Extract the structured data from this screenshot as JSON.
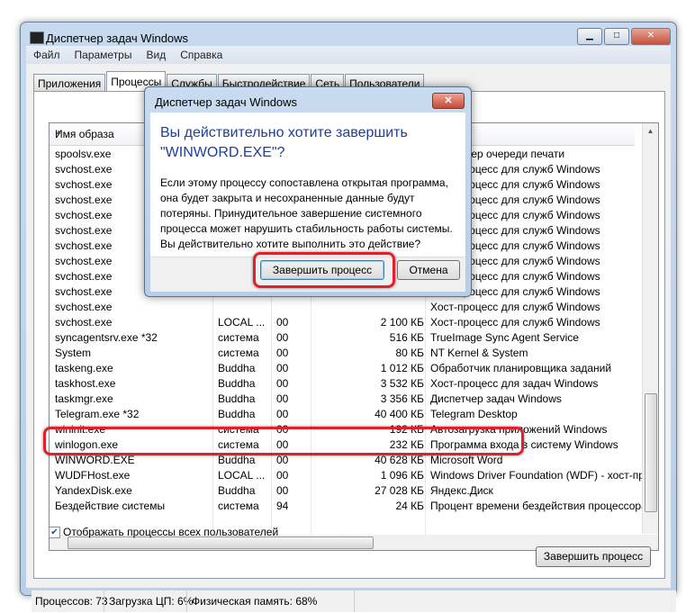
{
  "window": {
    "title": "Диспетчер задач Windows",
    "controls": [
      "minimize",
      "maximize",
      "close"
    ]
  },
  "menu": [
    "Файл",
    "Параметры",
    "Вид",
    "Справка"
  ],
  "tabs": [
    {
      "label": "Приложения"
    },
    {
      "label": "Процессы",
      "active": true
    },
    {
      "label": "Службы"
    },
    {
      "label": "Быстродействие"
    },
    {
      "label": "Сеть"
    },
    {
      "label": "Пользователи"
    }
  ],
  "table": {
    "header": {
      "name": "Имя образа"
    },
    "rows": [
      [
        "spoolsv.exe",
        "",
        "",
        "",
        "Диспетчер очереди печати"
      ],
      [
        "svchost.exe",
        "",
        "",
        "",
        "Хост-процесс для служб Windows"
      ],
      [
        "svchost.exe",
        "",
        "",
        "",
        "Хост-процесс для служб Windows"
      ],
      [
        "svchost.exe",
        "",
        "",
        "",
        "Хост-процесс для служб Windows"
      ],
      [
        "svchost.exe",
        "",
        "",
        "",
        "Хост-процесс для служб Windows"
      ],
      [
        "svchost.exe",
        "",
        "",
        "",
        "Хост-процесс для служб Windows"
      ],
      [
        "svchost.exe",
        "",
        "",
        "",
        "Хост-процесс для служб Windows"
      ],
      [
        "svchost.exe",
        "",
        "",
        "",
        "Хост-процесс для служб Windows"
      ],
      [
        "svchost.exe",
        "",
        "",
        "",
        "Хост-процесс для служб Windows"
      ],
      [
        "svchost.exe",
        "",
        "",
        "",
        "Хост-процесс для служб Windows"
      ],
      [
        "svchost.exe",
        "",
        "",
        "",
        "Хост-процесс для служб Windows"
      ],
      [
        "svchost.exe",
        "LOCAL ...",
        "00",
        "2 100 КБ",
        "Хост-процесс для служб Windows"
      ],
      [
        "syncagentsrv.exe *32",
        "система",
        "00",
        "516 КБ",
        "TrueImage Sync Agent Service"
      ],
      [
        "System",
        "система",
        "00",
        "80 КБ",
        "NT Kernel & System"
      ],
      [
        "taskeng.exe",
        "Buddha",
        "00",
        "1 012 КБ",
        "Обработчик планировщика заданий"
      ],
      [
        "taskhost.exe",
        "Buddha",
        "00",
        "3 532 КБ",
        "Хост-процесс для задач Windows"
      ],
      [
        "taskmgr.exe",
        "Buddha",
        "00",
        "3 356 КБ",
        "Диспетчер задач Windows"
      ],
      [
        "Telegram.exe *32",
        "Buddha",
        "00",
        "40 400 КБ",
        "Telegram Desktop"
      ],
      [
        "wininit.exe",
        "система",
        "00",
        "192 КБ",
        "Автозагрузка приложений Windows"
      ],
      [
        "winlogon.exe",
        "система",
        "00",
        "232 КБ",
        "Программа входа в систему Windows"
      ],
      [
        "WINWORD.EXE",
        "Buddha",
        "00",
        "40 628 КБ",
        "Microsoft Word"
      ],
      [
        "WUDFHost.exe",
        "LOCAL ...",
        "00",
        "1 096 КБ",
        "Windows Driver Foundation (WDF) - хост-процесс"
      ],
      [
        "YandexDisk.exe",
        "Buddha",
        "00",
        "27 028 КБ",
        "Яндекс.Диск"
      ],
      [
        "Бездействие системы",
        "система",
        "94",
        "24 КБ",
        "Процент времени бездействия процессора"
      ]
    ],
    "highlighted_row": "WINWORD.EXE"
  },
  "show_all_label": "Отображать процессы всех пользователей",
  "show_all_checked": true,
  "end_process_button": "Завершить процесс",
  "status": {
    "processes": "Процессов: 73",
    "cpu": "Загрузка ЦП: 6%",
    "memory": "Физическая память: 68%"
  },
  "dialog": {
    "title": "Диспетчер задач Windows",
    "heading": "Вы действительно хотите завершить \"WINWORD.EXE\"?",
    "text": "Если этому процессу сопоставлена открытая программа, она будет закрыта и несохраненные данные будут потеряны. Принудительное завершение системного процесса может нарушить стабильность работы системы. Вы действительно хотите выполнить это действие?",
    "confirm": "Завершить процесс",
    "cancel": "Отмена"
  },
  "colors": {
    "highlight": "#e0202a",
    "heading": "#1e3f9a"
  }
}
